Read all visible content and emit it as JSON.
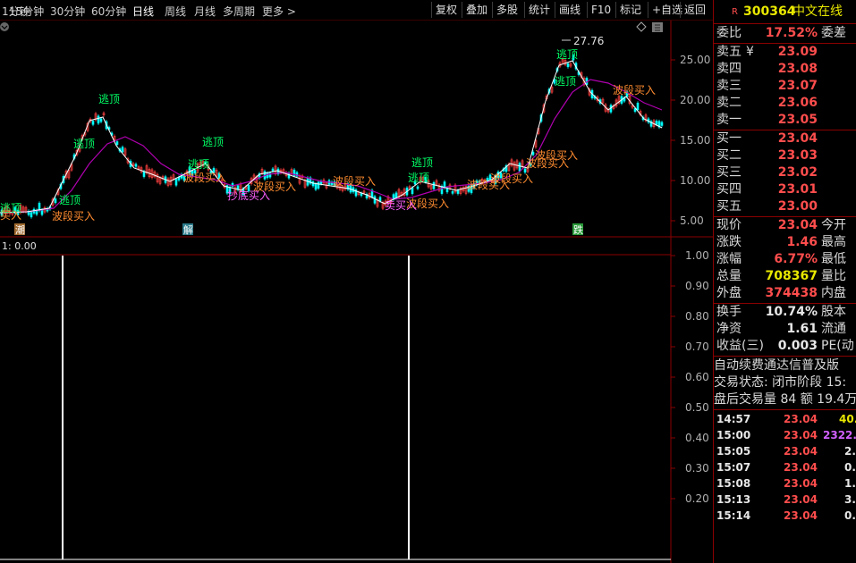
{
  "toolbar": {
    "periods": [
      "1分钟",
      "15分钟",
      "30分钟",
      "60分钟",
      "日线",
      "周线",
      "月线",
      "多周期",
      "更多 >"
    ],
    "active_period": "日线",
    "buttons": [
      "复权",
      "叠加",
      "多股",
      "统计",
      "画线",
      "F10",
      "标记",
      "+自选",
      "返回"
    ]
  },
  "main_chart": {
    "price_axis": [
      "25.00",
      "20.00",
      "15.00",
      "10.00",
      "5.00"
    ],
    "peak_label": "27.76",
    "signals": {
      "escape": "逃顶",
      "buy": "波段买入",
      "bottom_buy": "抄底买入",
      "sell_buy": "卖买入",
      "short_buy": "买入"
    },
    "bottom_markers": [
      "潮",
      "解",
      "跌"
    ],
    "colors": {
      "candle_up": "#ff4040",
      "candle_down": "#00ffff",
      "ma_short": "#ffffff",
      "ma_long": "#b000b0",
      "signal_escape": "#00ff66",
      "signal_buy": "#ff8c30"
    }
  },
  "sub_chart": {
    "header": "1: 0.00",
    "axis": [
      "1.00",
      "0.90",
      "0.80",
      "0.70",
      "0.60",
      "0.50",
      "0.40",
      "0.30",
      "0.20"
    ],
    "spikes": [
      {
        "bar": "spike-1",
        "value": 1.0
      },
      {
        "bar": "spike-2",
        "value": 1.0
      }
    ]
  },
  "quote": {
    "code": "300364",
    "name": "中文在线",
    "badge": "R",
    "ratio": {
      "label": "委比",
      "value": "17.52%",
      "label2": "委差"
    },
    "asks": [
      {
        "label": "卖五",
        "extra": "¥",
        "price": "23.09"
      },
      {
        "label": "卖四",
        "price": "23.08"
      },
      {
        "label": "卖三",
        "price": "23.07"
      },
      {
        "label": "卖二",
        "price": "23.06"
      },
      {
        "label": "卖一",
        "price": "23.05"
      }
    ],
    "bids": [
      {
        "label": "买一",
        "price": "23.04"
      },
      {
        "label": "买二",
        "price": "23.03"
      },
      {
        "label": "买三",
        "price": "23.02"
      },
      {
        "label": "买四",
        "price": "23.01"
      },
      {
        "label": "买五",
        "price": "23.00"
      }
    ],
    "stats": [
      {
        "label": "现价",
        "value": "23.04",
        "label2": "今开",
        "color": "red"
      },
      {
        "label": "涨跌",
        "value": "1.46",
        "label2": "最高",
        "color": "red"
      },
      {
        "label": "涨幅",
        "value": "6.77%",
        "label2": "最低",
        "color": "red"
      },
      {
        "label": "总量",
        "value": "708367",
        "label2": "量比",
        "color": "yellow"
      },
      {
        "label": "外盘",
        "value": "374438",
        "label2": "内盘",
        "color": "red"
      }
    ],
    "stats2": [
      {
        "label": "换手",
        "value": "10.74%",
        "label2": "股本",
        "color": "white"
      },
      {
        "label": "净资",
        "value": "1.61",
        "label2": "流通",
        "color": "white"
      },
      {
        "label": "收益(三)",
        "value": "0.003",
        "label2": "PE(动",
        "color": "white"
      }
    ],
    "info": [
      "自动续费通达信普及版",
      "交易状态: 闭市阶段 15:",
      "盘后交易量 84 额 19.4万"
    ],
    "ticks": [
      {
        "time": "14:57",
        "price": "23.04",
        "vol": "40.",
        "vcolor": "yellow"
      },
      {
        "time": "15:00",
        "price": "23.04",
        "vol": "2322.",
        "vcolor": "magenta"
      },
      {
        "time": "15:05",
        "price": "23.04",
        "vol": "2.",
        "vcolor": "white"
      },
      {
        "time": "15:07",
        "price": "23.04",
        "vol": "0.",
        "vcolor": "white"
      },
      {
        "time": "15:08",
        "price": "23.04",
        "vol": "1.",
        "vcolor": "white"
      },
      {
        "time": "15:13",
        "price": "23.04",
        "vol": "3.",
        "vcolor": "white"
      },
      {
        "time": "15:14",
        "price": "23.04",
        "vol": "0.",
        "vcolor": "white"
      }
    ]
  }
}
